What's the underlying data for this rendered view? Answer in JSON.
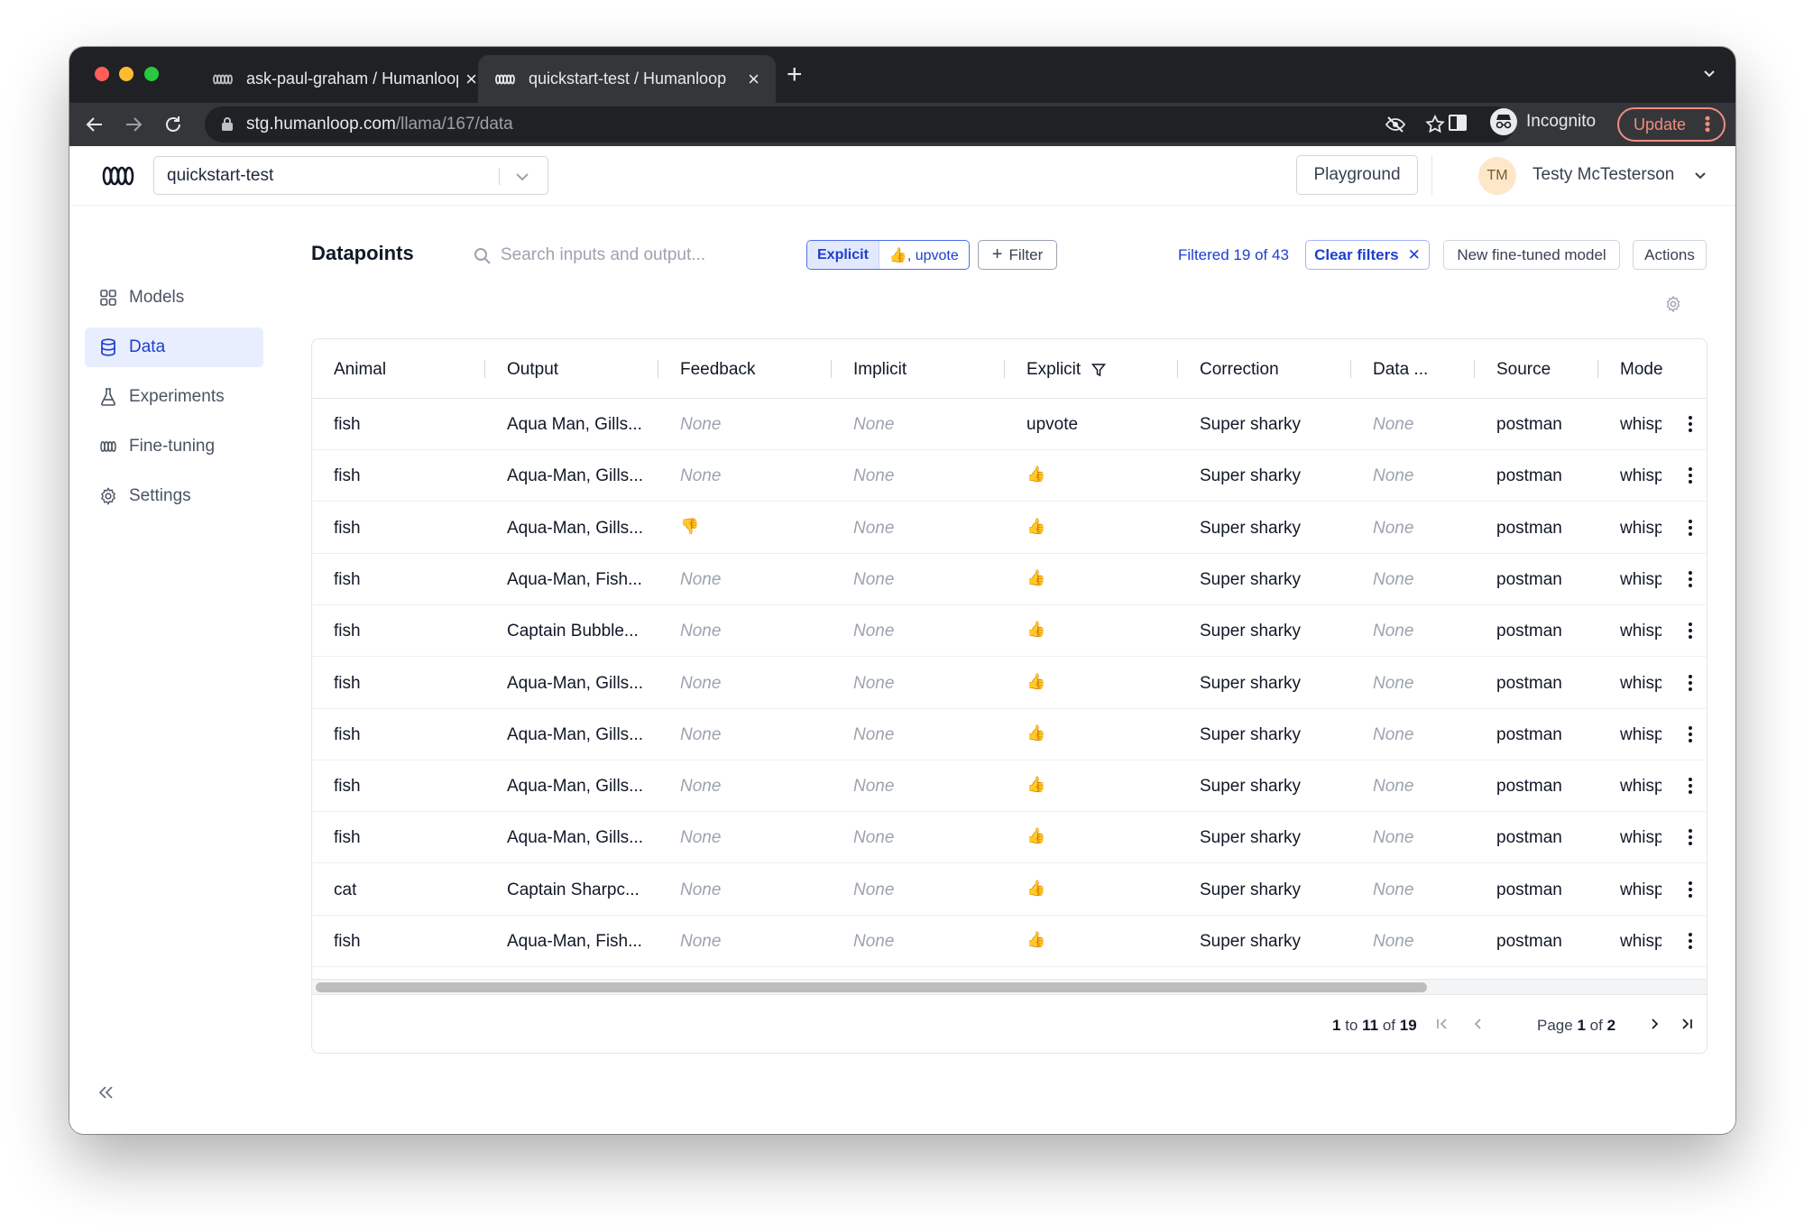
{
  "browser": {
    "tabs": [
      {
        "title": "ask-paul-graham / Humanloop",
        "active": false
      },
      {
        "title": "quickstart-test / Humanloop",
        "active": true
      }
    ],
    "url_host": "stg.humanloop.com",
    "url_path": "/llama/167/data",
    "profile_label": "Incognito",
    "update_label": "Update"
  },
  "header": {
    "project": "quickstart-test",
    "playground_label": "Playground",
    "user_initials": "TM",
    "user_name": "Testy McTesterson"
  },
  "sidebar": {
    "items": [
      {
        "label": "Models",
        "icon": "grid-icon",
        "active": false
      },
      {
        "label": "Data",
        "icon": "database-icon",
        "active": true
      },
      {
        "label": "Experiments",
        "icon": "flask-icon",
        "active": false
      },
      {
        "label": "Fine-tuning",
        "icon": "humanloop-icon",
        "active": false
      },
      {
        "label": "Settings",
        "icon": "gear-icon",
        "active": false
      }
    ]
  },
  "toolbar": {
    "title": "Datapoints",
    "search_placeholder": "Search inputs and output...",
    "active_filter_key": "Explicit",
    "active_filter_value": "👍, upvote",
    "filter_label": "Filter",
    "filtered_prefix": "Filtered",
    "filtered_count": "19",
    "filtered_of": "of",
    "filtered_total": "43",
    "clear_filters_label": "Clear filters",
    "new_model_label": "New fine-tuned model",
    "actions_label": "Actions"
  },
  "table": {
    "columns": [
      "Animal",
      "Output",
      "Feedback",
      "Implicit",
      "Explicit",
      "Correction",
      "Data ...",
      "Source",
      "Mode"
    ],
    "rows": [
      [
        "fish",
        "Aqua Man, Gills...",
        "None",
        "None",
        "upvote",
        "Super sharky",
        "None",
        "postman",
        "whisp"
      ],
      [
        "fish",
        "Aqua-Man, Gills...",
        "None",
        "None",
        "👍",
        "Super sharky",
        "None",
        "postman",
        "whisp"
      ],
      [
        "fish",
        "Aqua-Man, Gills...",
        "👎",
        "None",
        "👍",
        "Super sharky",
        "None",
        "postman",
        "whisp"
      ],
      [
        "fish",
        "Aqua-Man, Fish...",
        "None",
        "None",
        "👍",
        "Super sharky",
        "None",
        "postman",
        "whisp"
      ],
      [
        "fish",
        "Captain Bubble...",
        "None",
        "None",
        "👍",
        "Super sharky",
        "None",
        "postman",
        "whisp"
      ],
      [
        "fish",
        "Aqua-Man, Gills...",
        "None",
        "None",
        "👍",
        "Super sharky",
        "None",
        "postman",
        "whisp"
      ],
      [
        "fish",
        "Aqua-Man, Gills...",
        "None",
        "None",
        "👍",
        "Super sharky",
        "None",
        "postman",
        "whisp"
      ],
      [
        "fish",
        "Aqua-Man, Gills...",
        "None",
        "None",
        "👍",
        "Super sharky",
        "None",
        "postman",
        "whisp"
      ],
      [
        "fish",
        "Aqua-Man, Gills...",
        "None",
        "None",
        "👍",
        "Super sharky",
        "None",
        "postman",
        "whisp"
      ],
      [
        "cat",
        "Captain Sharpc...",
        "None",
        "None",
        "👍",
        "Super sharky",
        "None",
        "postman",
        "whisp"
      ],
      [
        "fish",
        "Aqua-Man, Fish...",
        "None",
        "None",
        "👍",
        "Super sharky",
        "None",
        "postman",
        "whisp"
      ]
    ]
  },
  "pagination": {
    "range_start": "1",
    "range_to": "to",
    "range_end": "11",
    "range_of": "of",
    "range_total": "19",
    "page_label": "Page",
    "page_current": "1",
    "page_of": "of",
    "page_total": "2"
  },
  "colors": {
    "accent": "#1d3fd0",
    "active_nav_bg": "#e8eefe",
    "browser_dark": "#202124",
    "update_pink": "#f28b82"
  }
}
